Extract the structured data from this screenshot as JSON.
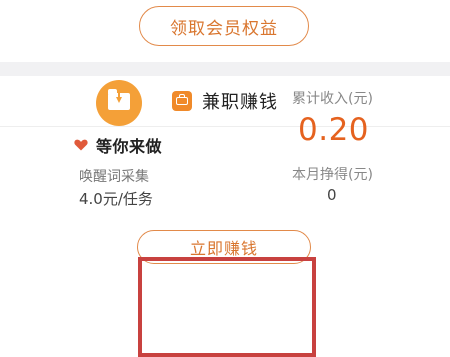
{
  "top": {
    "member_button": "领取会员权益"
  },
  "section": {
    "header_icon": "briefcase-icon",
    "title": "兼职赚钱"
  },
  "task": {
    "icon": "folder-download-icon",
    "heart_icon": "heart-icon",
    "title": "等你来做",
    "name": "唤醒词采集",
    "price": "4.0元/任务"
  },
  "stats": {
    "total_income_label": "累计收入(元)",
    "total_income_value": "0.20",
    "month_label": "本月挣得(元)",
    "month_value": "0"
  },
  "earn_button": "立即赚钱",
  "colors": {
    "accent": "#e28a4a",
    "value": "#e5621f",
    "icon_bg": "#f4a038",
    "heart": "#e05a3a",
    "highlight": "#c8413f"
  }
}
